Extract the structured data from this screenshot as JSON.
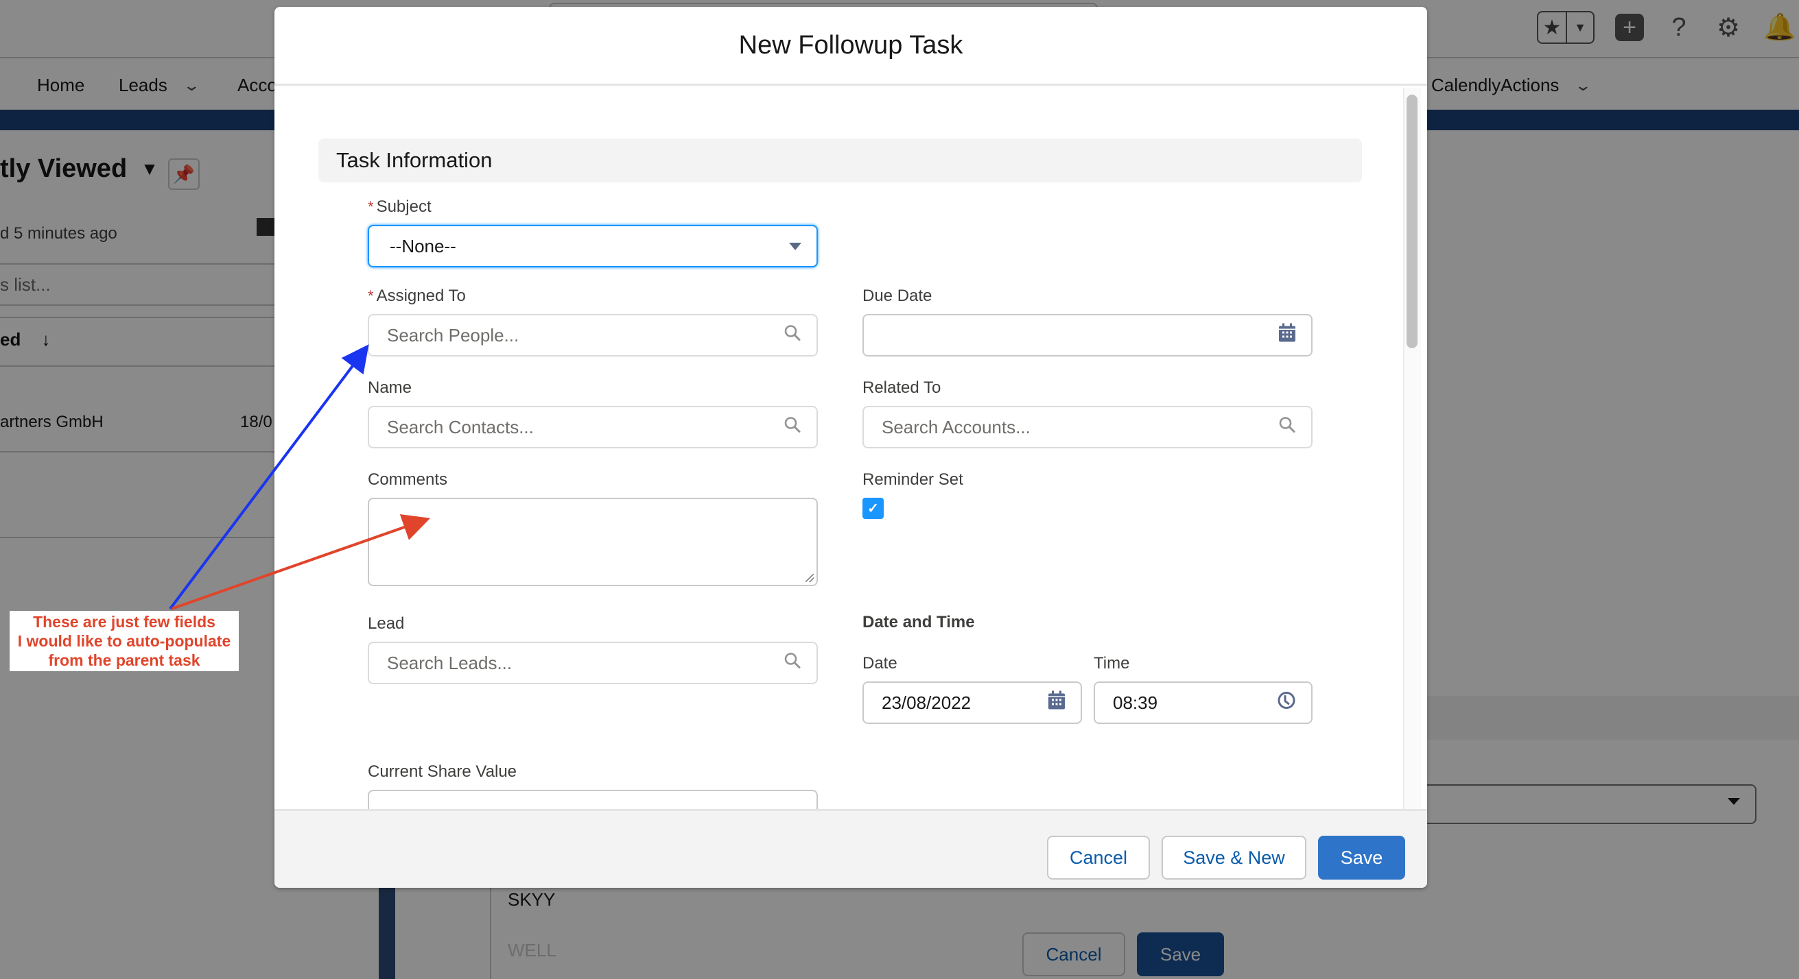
{
  "background": {
    "nav": {
      "items": [
        {
          "label": "Home",
          "has_menu": false
        },
        {
          "label": "Leads",
          "has_menu": true
        },
        {
          "label": "Acco",
          "has_menu": false
        },
        {
          "label": "CalendlyActions",
          "has_menu": true
        }
      ]
    },
    "header_icons": [
      "favorites-star-icon",
      "favorites-dropdown-icon",
      "global-create-icon",
      "help-icon",
      "setup-gear-icon",
      "notifications-bell-icon"
    ],
    "list_view": {
      "title": "tly Viewed",
      "updated": "d 5 minutes ago",
      "search_placeholder": "s list...",
      "sort_column": "ed",
      "row": {
        "name": "artners GmbH",
        "date": "18/0"
      }
    },
    "lower_table": {
      "rows": [
        "SKYY",
        "WELL"
      ]
    },
    "lower_buttons": {
      "cancel": "Cancel",
      "save": "Save"
    }
  },
  "modal": {
    "title": "New Followup Task",
    "section_title": "Task Information",
    "fields": {
      "subject": {
        "label": "Subject",
        "required": true,
        "value": "--None--"
      },
      "assigned_to": {
        "label": "Assigned To",
        "required": true,
        "placeholder": "Search People..."
      },
      "due_date": {
        "label": "Due Date",
        "value": ""
      },
      "name": {
        "label": "Name",
        "placeholder": "Search Contacts..."
      },
      "related_to": {
        "label": "Related To",
        "placeholder": "Search Accounts..."
      },
      "comments": {
        "label": "Comments",
        "value": ""
      },
      "reminder_set": {
        "label": "Reminder Set",
        "checked": true,
        "check_glyph": "✓"
      },
      "lead": {
        "label": "Lead",
        "placeholder": "Search Leads..."
      },
      "date_and_time": {
        "label": "Date and Time"
      },
      "date": {
        "label": "Date",
        "value": "23/08/2022"
      },
      "time": {
        "label": "Time",
        "value": "08:39"
      },
      "current_share_value": {
        "label": "Current Share Value",
        "value": ""
      }
    },
    "required_marker": "*",
    "footer": {
      "cancel": "Cancel",
      "save_new": "Save & New",
      "save": "Save"
    }
  },
  "annotation": {
    "text_lines": [
      "These are just few fields",
      "I would like to auto-populate",
      "from the parent task"
    ],
    "arrow_colors": {
      "to_assigned": "#1a35f0",
      "to_comments": "#e0452b"
    }
  },
  "colors": {
    "brand": "#2e74c9",
    "focus": "#1b96ff",
    "required": "#c23934",
    "annotation_text": "#e0452b"
  }
}
